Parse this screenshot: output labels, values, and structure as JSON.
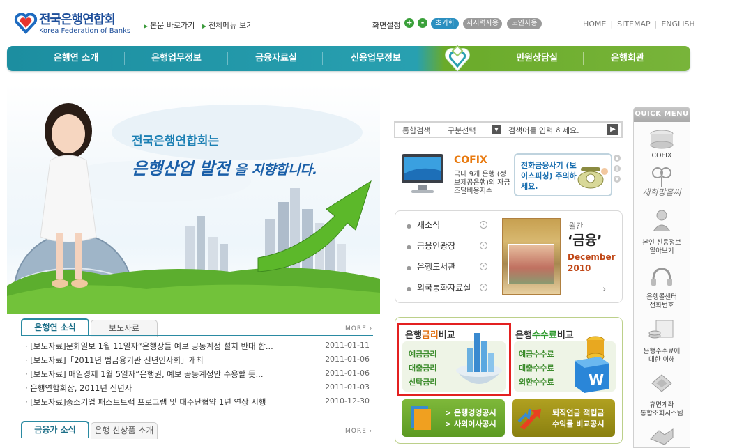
{
  "header": {
    "logo_ko": "전국은행연합회",
    "logo_en": "Korea Federation of Banks",
    "skip_links": [
      "본문 바로가기",
      "전체메뉴 보기"
    ],
    "screen_setting": "화면설정",
    "zoom_in": "+",
    "zoom_out": "-",
    "pills": [
      "초기화",
      "저시력자용",
      "노인자용"
    ],
    "util_links": [
      "HOME",
      "SITEMAP",
      "ENGLISH"
    ]
  },
  "nav": {
    "items": [
      "은행연 소개",
      "은행업무정보",
      "금융자료실",
      "신용업무정보",
      "민원상담실",
      "은행회관"
    ]
  },
  "hero": {
    "line1": "전국은행연합회는",
    "line2_strong": "은행산업 발전",
    "line2_rest": "을 지향합니다."
  },
  "news1": {
    "tabs": [
      "은행연 소식",
      "보도자료"
    ],
    "more": "MORE ›",
    "items": [
      {
        "title": "· [보도자료]문화일보 1월 11일자“은행장들 예보 공동계정 설치 반대 합...",
        "date": "2011-01-11"
      },
      {
        "title": "· [보도자료]「2011년 범금융기관 신년인사회」개최",
        "date": "2011-01-06"
      },
      {
        "title": "· [보도자료] 매일경제 1월 5일자“은행권, 예보 공동계정안 수용할 듯...",
        "date": "2011-01-06"
      },
      {
        "title": "· 은행연합회장, 2011년 신년사",
        "date": "2011-01-03"
      },
      {
        "title": "· [보도자료]중소기업 패스트트랙 프로그램 및 대주단협약 1년 연장 시행",
        "date": "2010-12-30"
      }
    ]
  },
  "news2": {
    "tabs": [
      "금융가 소식",
      "은행 신상품 소개"
    ],
    "more": "MORE ›"
  },
  "search": {
    "label": "통합검색",
    "select": "구분선택",
    "placeholder": "검색어를 입력 하세요."
  },
  "cofix": {
    "title": "COFIX",
    "desc": "국내 9개 은행 (정보제공은행)의 자금조달비용지수"
  },
  "phishing": {
    "text": "전화금융사기 (보이스피싱) 주의하세요."
  },
  "links": [
    "새소식",
    "금융인광장",
    "은행도서관",
    "외국통화자료실"
  ],
  "magazine": {
    "small": "월간",
    "title": "‘금융’",
    "month": "December",
    "year": "2010",
    "more_arrow": "›"
  },
  "rates": {
    "heading_pre": "은행",
    "heading_hl": "금리",
    "heading_post": "비교",
    "items": [
      "예금금리",
      "대출금리",
      "신탁금리"
    ]
  },
  "fees": {
    "heading_pre": "은행",
    "heading_hl": "수수료",
    "heading_post": "비교",
    "items": [
      "예금수수료",
      "대출수수료",
      "외환수수료"
    ]
  },
  "green_buttons": {
    "left": [
      "> 은행경영공시",
      "> 사외이사공시"
    ],
    "right": [
      "퇴직연금 적립금",
      "수익률 비교공시"
    ]
  },
  "quick_menu": {
    "title": "QUICK MENU",
    "items": [
      "COFIX",
      "새희망홀씨",
      "본인 신용정보\n알아보기",
      "은행콜센터\n전화번호",
      "은행수수료에\n대한 이해",
      "휴면계좌\n통합조회시스템"
    ]
  },
  "colors": {
    "nav_teal": "#1c8ea0",
    "nav_green": "#78b43a",
    "brand_blue": "#1d4e9a",
    "highlight_red": "#e32020"
  }
}
